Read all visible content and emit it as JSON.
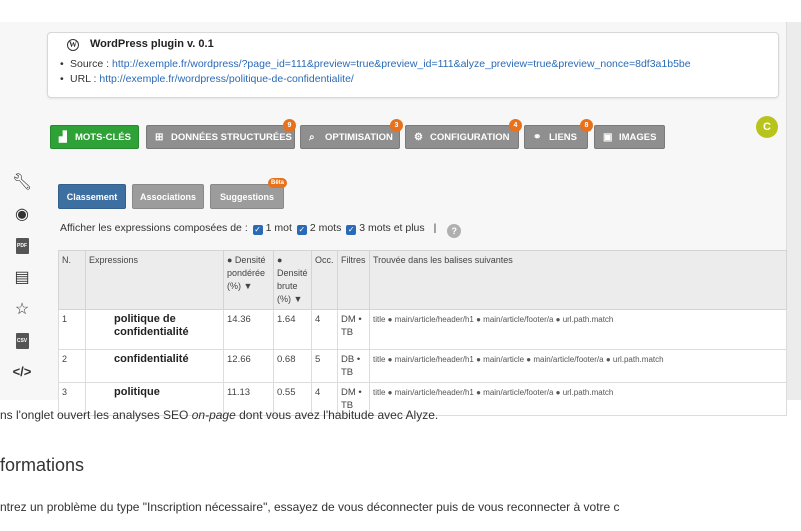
{
  "plugin": {
    "title": "WordPress plugin v. 0.1",
    "source_label": "Source :",
    "source_url": "http://exemple.fr/wordpress/?page_id=111&preview=true&preview_id=111&alyze_preview=true&preview_nonce=8df3a1b5be",
    "url_label": "URL :",
    "url_value": "http://exemple.fr/wordpress/politique-de-confidentialite/"
  },
  "avatar_letter": "C",
  "tabs": [
    {
      "label": "MOTS-CLÉS",
      "icon": "bar-chart-icon",
      "active": true,
      "badge": ""
    },
    {
      "label": "DONNÉES STRUCTURÉES",
      "icon": "sitemap-icon",
      "active": false,
      "badge": "9"
    },
    {
      "label": "OPTIMISATION",
      "icon": "search-icon",
      "active": false,
      "badge": "3"
    },
    {
      "label": "CONFIGURATION",
      "icon": "gear-icon",
      "active": false,
      "badge": "4"
    },
    {
      "label": "LIENS",
      "icon": "link-icon",
      "active": false,
      "badge": "8"
    },
    {
      "label": "IMAGES",
      "icon": "image-icon",
      "active": false,
      "badge": ""
    }
  ],
  "sidebar_icons": [
    "wrench-icon",
    "eye-icon",
    "pdf-icon",
    "save-icon",
    "star-icon",
    "csv-icon",
    "code-icon"
  ],
  "sidebar_labels": {
    "pdf": "PDF",
    "csv": "CSV"
  },
  "subtabs": {
    "classement": "Classement",
    "associations": "Associations",
    "suggestions": "Suggestions",
    "suggestions_badge": "Bêta"
  },
  "filter": {
    "label": "Afficher les expressions composées de :",
    "opt1": "1 mot",
    "opt2": "2 mots",
    "opt3": "3 mots et plus",
    "separator": "|",
    "help": "?"
  },
  "table": {
    "headers": {
      "n": "N.",
      "expressions": "Expressions",
      "densite_ponderee": "● Densité pondérée (%) ▼",
      "densite_brute": "● Densité brute (%) ▼",
      "occ": "Occ.",
      "filtres": "Filtres",
      "balises": "Trouvée dans les balises suivantes"
    },
    "rows": [
      {
        "n": "1",
        "expr": "politique de confidentialité",
        "dp": "14.36",
        "db": "1.64",
        "occ": "4",
        "filtres": "DM • TB",
        "tags": "title ● main/article/header/h1 ● main/article/footer/a ● url.path.match"
      },
      {
        "n": "2",
        "expr": "confidentialité",
        "dp": "12.66",
        "db": "0.68",
        "occ": "5",
        "filtres": "DB • TB",
        "tags": "title ● main/article/header/h1 ● main/article ● main/article/footer/a ● url.path.match"
      },
      {
        "n": "3",
        "expr": "politique",
        "dp": "11.13",
        "db": "0.55",
        "occ": "4",
        "filtres": "DM • TB",
        "tags": "title ● main/article/header/h1 ● main/article/footer/a ● url.path.match"
      }
    ]
  },
  "page": {
    "line1_a": "ns l'onglet ouvert les analyses SEO ",
    "line1_em": "on-page",
    "line1_b": " dont vous avez l'habitude avec Alyze.",
    "heading": "formations",
    "line2": "ntrez un problème du type \"Inscription nécessaire\", essayez de vous déconnecter puis de vous reconnecter à votre c"
  },
  "colors": {
    "accent_green": "#2ea237",
    "tab_gray": "#8f8f8f",
    "badge_orange": "#e8721c",
    "link_blue": "#2a6ab6",
    "subtab_blue": "#3d6fa1",
    "avatar": "#b8c41c"
  }
}
